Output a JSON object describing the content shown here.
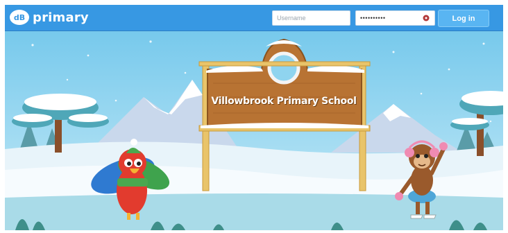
{
  "header": {
    "logo_badge": "dB",
    "logo_text": "primary",
    "username_placeholder": "Username",
    "password_value": "••••••••••",
    "login_label": "Log in",
    "password_icon": "key-icon"
  },
  "scene": {
    "sign_text": "Villowbrook Primary School"
  },
  "colors": {
    "topbar": "#3798e3",
    "login_button": "#59b5f2",
    "sky": "#8fd4ef",
    "snow": "#eef6fb",
    "sign_wood": "#b87333"
  }
}
